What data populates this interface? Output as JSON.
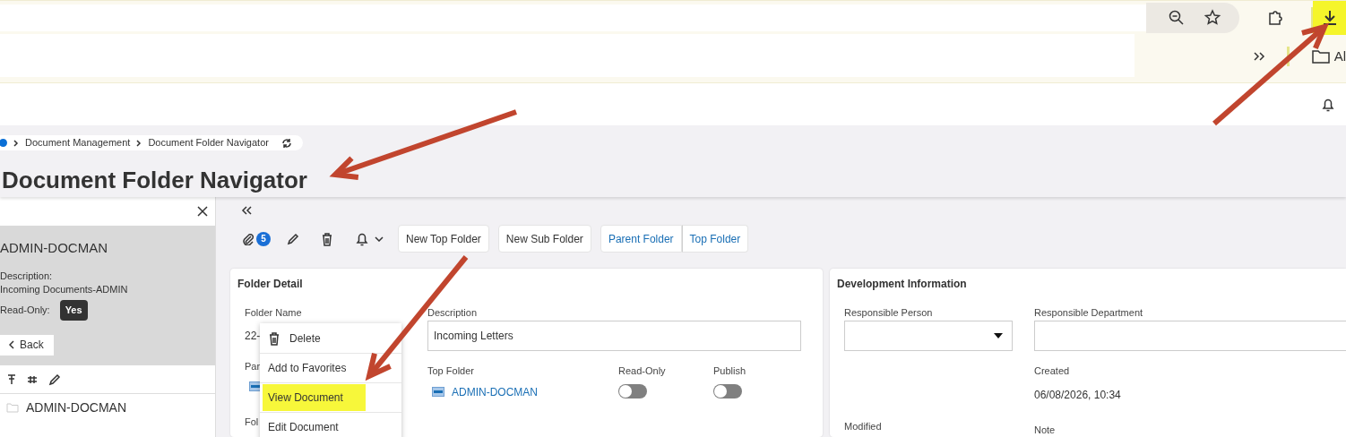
{
  "browser": {
    "bookmark_item": "Al"
  },
  "breadcrumb": [
    "Document Management",
    "Document Folder Navigator"
  ],
  "page_title": "Document Folder Navigator",
  "side_panel": {
    "title": "ADMIN-DOCMAN",
    "description_label": "Description:",
    "description": "Incoming Documents-ADMIN",
    "read_only_label": "Read-Only:",
    "read_only_value": "Yes",
    "back": "Back",
    "tree": [
      {
        "label": "ADMIN-DOCMAN"
      }
    ]
  },
  "toolbar": {
    "attachments_count": "5",
    "buttons": [
      {
        "label": "New Top Folder",
        "kind": "plain"
      },
      {
        "label": "New Sub Folder",
        "kind": "plain"
      },
      {
        "label": "Parent Folder",
        "kind": "link"
      },
      {
        "label": "Top Folder",
        "kind": "link"
      }
    ]
  },
  "folder_detail": {
    "title": "Folder Detail",
    "folder_name_label": "Folder Name",
    "folder_name_value": "22-",
    "parent_label": "Par",
    "next_label": "Fol",
    "description_label": "Description",
    "description": "Incoming Letters",
    "top_folder_label": "Top Folder",
    "top_folder": "ADMIN-DOCMAN",
    "toggles": [
      {
        "label": "Read-Only",
        "on": false
      },
      {
        "label": "Publish",
        "on": false
      }
    ]
  },
  "development_info": {
    "title": "Development Information",
    "responsible_person_label": "Responsible Person",
    "responsible_department_label": "Responsible Department",
    "created_label": "Created",
    "created": "06/08/2026, 10:34",
    "modified_label": "Modified",
    "note_label": "Note"
  },
  "context_menu": [
    {
      "label": "Delete",
      "kind": "icon",
      "selected": false
    },
    {
      "label": "Add to Favorites",
      "kind": "plain",
      "selected": false
    },
    {
      "label": "View Document",
      "kind": "plain",
      "selected": true
    },
    {
      "label": "Edit Document",
      "kind": "plain",
      "selected": false
    }
  ]
}
